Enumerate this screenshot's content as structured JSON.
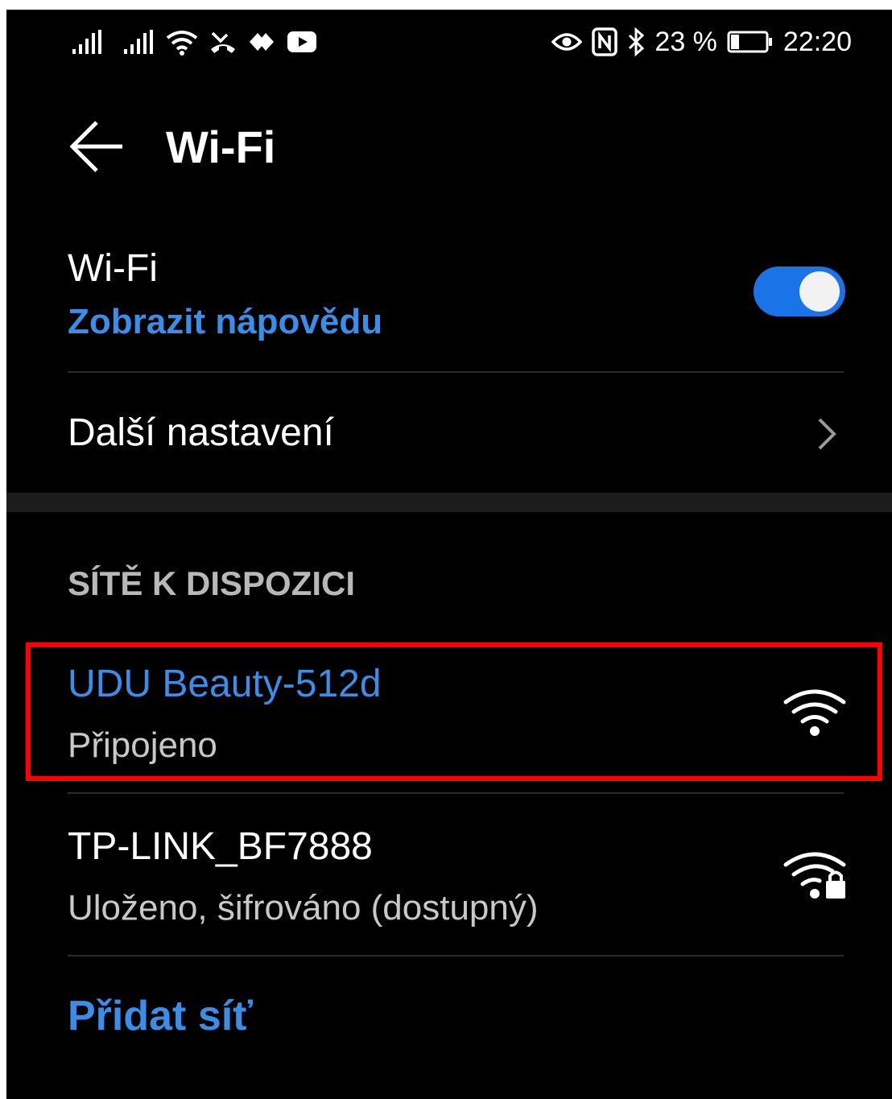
{
  "status_bar": {
    "battery_text": "23 %",
    "battery_level": 0.23,
    "time": "22:20",
    "icons_left": [
      "signal-icon",
      "signal-icon",
      "wifi-icon",
      "missed-call-icon",
      "data-saver-icon",
      "youtube-icon"
    ],
    "icons_right": [
      "eye-icon",
      "nfc-icon",
      "bluetooth-icon",
      "battery-icon"
    ]
  },
  "header": {
    "title": "Wi-Fi",
    "back_icon": "arrow-left-icon"
  },
  "wifi_toggle": {
    "label": "Wi-Fi",
    "help_link": "Zobrazit nápovědu",
    "enabled": true
  },
  "more_settings": {
    "label": "Další nastavení",
    "icon": "chevron-right-icon"
  },
  "available_networks": {
    "header": "SÍTĚ K DISPOZICI",
    "items": [
      {
        "name": "UDU Beauty-512d",
        "status": "Připojeno",
        "secured": false,
        "highlighted": true
      },
      {
        "name": "TP-LINK_BF7888",
        "status": "Uloženo, šifrováno (dostupný)",
        "secured": true,
        "highlighted": false
      }
    ]
  },
  "add_network": {
    "label": "Přidat síť"
  },
  "colors": {
    "background": "#000000",
    "accent": "#3b8ee8",
    "toggle_on": "#1a74e8",
    "highlight": "#ff0000",
    "secondary_text": "#c8c8c8"
  }
}
